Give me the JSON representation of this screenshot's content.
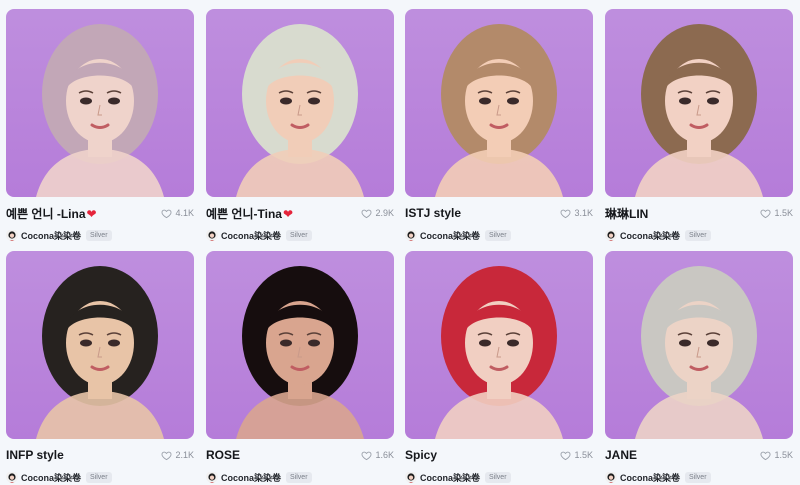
{
  "cards": [
    {
      "title": "예쁜 언니 -Lina",
      "has_heart": true,
      "likes": "4.1K",
      "author": "Cocona染染卷",
      "badge": "Silver",
      "bg": "#b57cd9",
      "hair": "#c2a7b7",
      "skin": "#efd3cb"
    },
    {
      "title": "예쁜 언니-Tina",
      "has_heart": true,
      "likes": "2.9K",
      "author": "Cocona染染卷",
      "badge": "Silver",
      "bg": "#7fcfb0",
      "hair": "#d8dbcf",
      "skin": "#f1cdb8"
    },
    {
      "title": "ISTJ style",
      "has_heart": false,
      "likes": "3.1K",
      "author": "Cocona染染卷",
      "badge": "Silver",
      "bg": "#e88d5a",
      "hair": "#b38a6a",
      "skin": "#f3cdb6"
    },
    {
      "title": "琳琳LIN",
      "has_heart": false,
      "likes": "1.5K",
      "author": "Cocona染染卷",
      "badge": "Silver",
      "bg": "#d9a8b7",
      "hair": "#8c6a50",
      "skin": "#f2d1c4"
    },
    {
      "title": "INFP style",
      "has_heart": false,
      "likes": "2.1K",
      "author": "Cocona染染卷",
      "badge": "Silver",
      "bg": "#8fb53f",
      "hair": "#26221f",
      "skin": "#e8c4a7"
    },
    {
      "title": "ROSE",
      "has_heart": false,
      "likes": "1.6K",
      "author": "Cocona染染卷",
      "badge": "Silver",
      "bg": "#5a1018",
      "hair": "#160d0e",
      "skin": "#d9a58f"
    },
    {
      "title": "Spicy",
      "has_heart": false,
      "likes": "1.5K",
      "author": "Cocona染染卷",
      "badge": "Silver",
      "bg": "#e8a0a8",
      "hair": "#c8283a",
      "skin": "#f1cfc2"
    },
    {
      "title": "JANE",
      "has_heart": false,
      "likes": "1.5K",
      "author": "Cocona染染卷",
      "badge": "Silver",
      "bg": "#c9d7c1",
      "hair": "#c9c7c2",
      "skin": "#ecd3c6"
    }
  ]
}
